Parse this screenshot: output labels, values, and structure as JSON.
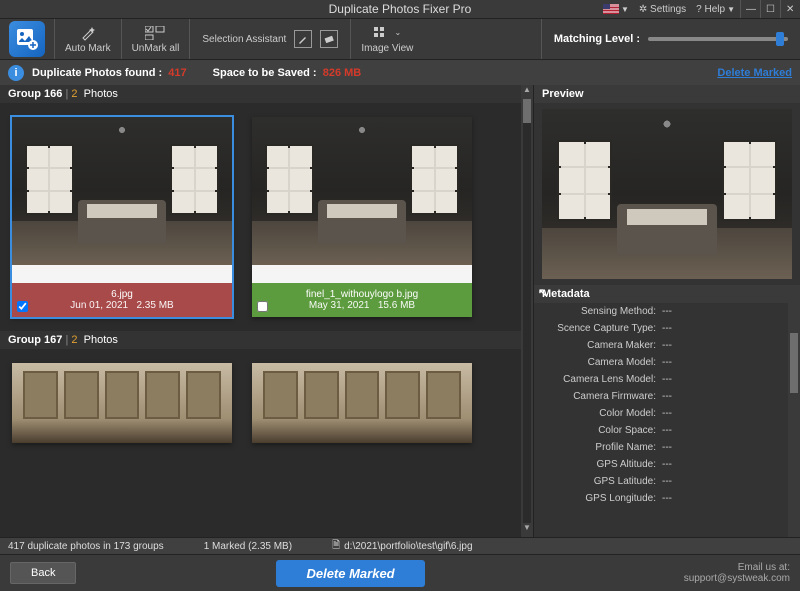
{
  "title": "Duplicate Photos Fixer Pro",
  "topmenu": {
    "settings": "Settings",
    "help": "? Help"
  },
  "ribbon": {
    "automark": "Auto Mark",
    "unmarkall": "UnMark all",
    "selasst": "Selection Assistant",
    "imageview": "Image View",
    "matchlevel": "Matching Level :"
  },
  "infobar": {
    "found_label": "Duplicate Photos found :",
    "found_value": "417",
    "save_label": "Space to be Saved :",
    "save_value": "826 MB",
    "delete_link": "Delete Marked"
  },
  "groups": [
    {
      "title": "Group 166",
      "count": "2",
      "count_label": "Photos",
      "items": [
        {
          "filename": "6.jpg",
          "date": "Jun 01, 2021",
          "size": "2.35 MB",
          "selected": true,
          "checked": true
        },
        {
          "filename": "finel_1_withouylogo b.jpg",
          "date": "May 31, 2021",
          "size": "15.6 MB",
          "selected": false,
          "checked": false
        }
      ]
    },
    {
      "title": "Group 167",
      "count": "2",
      "count_label": "Photos"
    }
  ],
  "preview": {
    "title": "Preview"
  },
  "metadata": {
    "title": "Metadata",
    "rows": [
      {
        "k": "Sensing Method:",
        "v": "---"
      },
      {
        "k": "Scence Capture Type:",
        "v": "---"
      },
      {
        "k": "Camera Maker:",
        "v": "---"
      },
      {
        "k": "Camera Model:",
        "v": "---"
      },
      {
        "k": "Camera Lens Model:",
        "v": "---"
      },
      {
        "k": "Camera Firmware:",
        "v": "---"
      },
      {
        "k": "Color Model:",
        "v": "---"
      },
      {
        "k": "Color Space:",
        "v": "---"
      },
      {
        "k": "Profile Name:",
        "v": "---"
      },
      {
        "k": "GPS Altitude:",
        "v": "---"
      },
      {
        "k": "GPS Latitude:",
        "v": "---"
      },
      {
        "k": "GPS Longitude:",
        "v": "---"
      }
    ]
  },
  "status": {
    "summary": "417 duplicate photos in 173 groups",
    "marked": "1 Marked (2.35 MB)",
    "path": "d:\\2021\\portfolio\\test\\gif\\6.jpg"
  },
  "footer": {
    "back": "Back",
    "delete": "Delete Marked",
    "email_label": "Email us at:",
    "email": "support@systweak.com"
  }
}
